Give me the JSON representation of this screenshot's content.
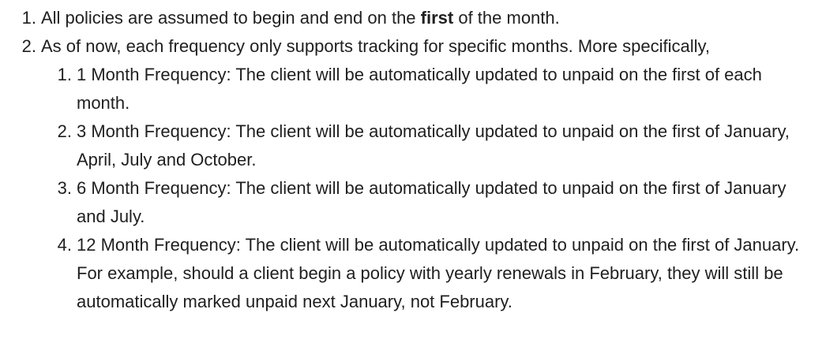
{
  "list": {
    "item1": {
      "number": "1.",
      "before": "All policies are assumed to begin and end on the ",
      "bold": "first",
      "after": " of the month."
    },
    "item2": {
      "number": "2.",
      "text": "As of now, each frequency only supports tracking for specific months. More specifically,",
      "subitems": [
        {
          "number": "1.",
          "text": "1 Month Frequency: The client will be automatically updated to unpaid on the first of each month."
        },
        {
          "number": "2.",
          "text": "3 Month Frequency: The client will be automatically updated to unpaid on the first of January, April, July and October."
        },
        {
          "number": "3.",
          "text": "6 Month Frequency: The client will be automatically updated to unpaid on the first of January and July."
        },
        {
          "number": "4.",
          "text": "12 Month Frequency: The client will be automatically updated to unpaid on the first of January. For example, should a client begin a policy with yearly renewals in February, they will still be automatically marked unpaid next January, not February."
        }
      ]
    }
  }
}
